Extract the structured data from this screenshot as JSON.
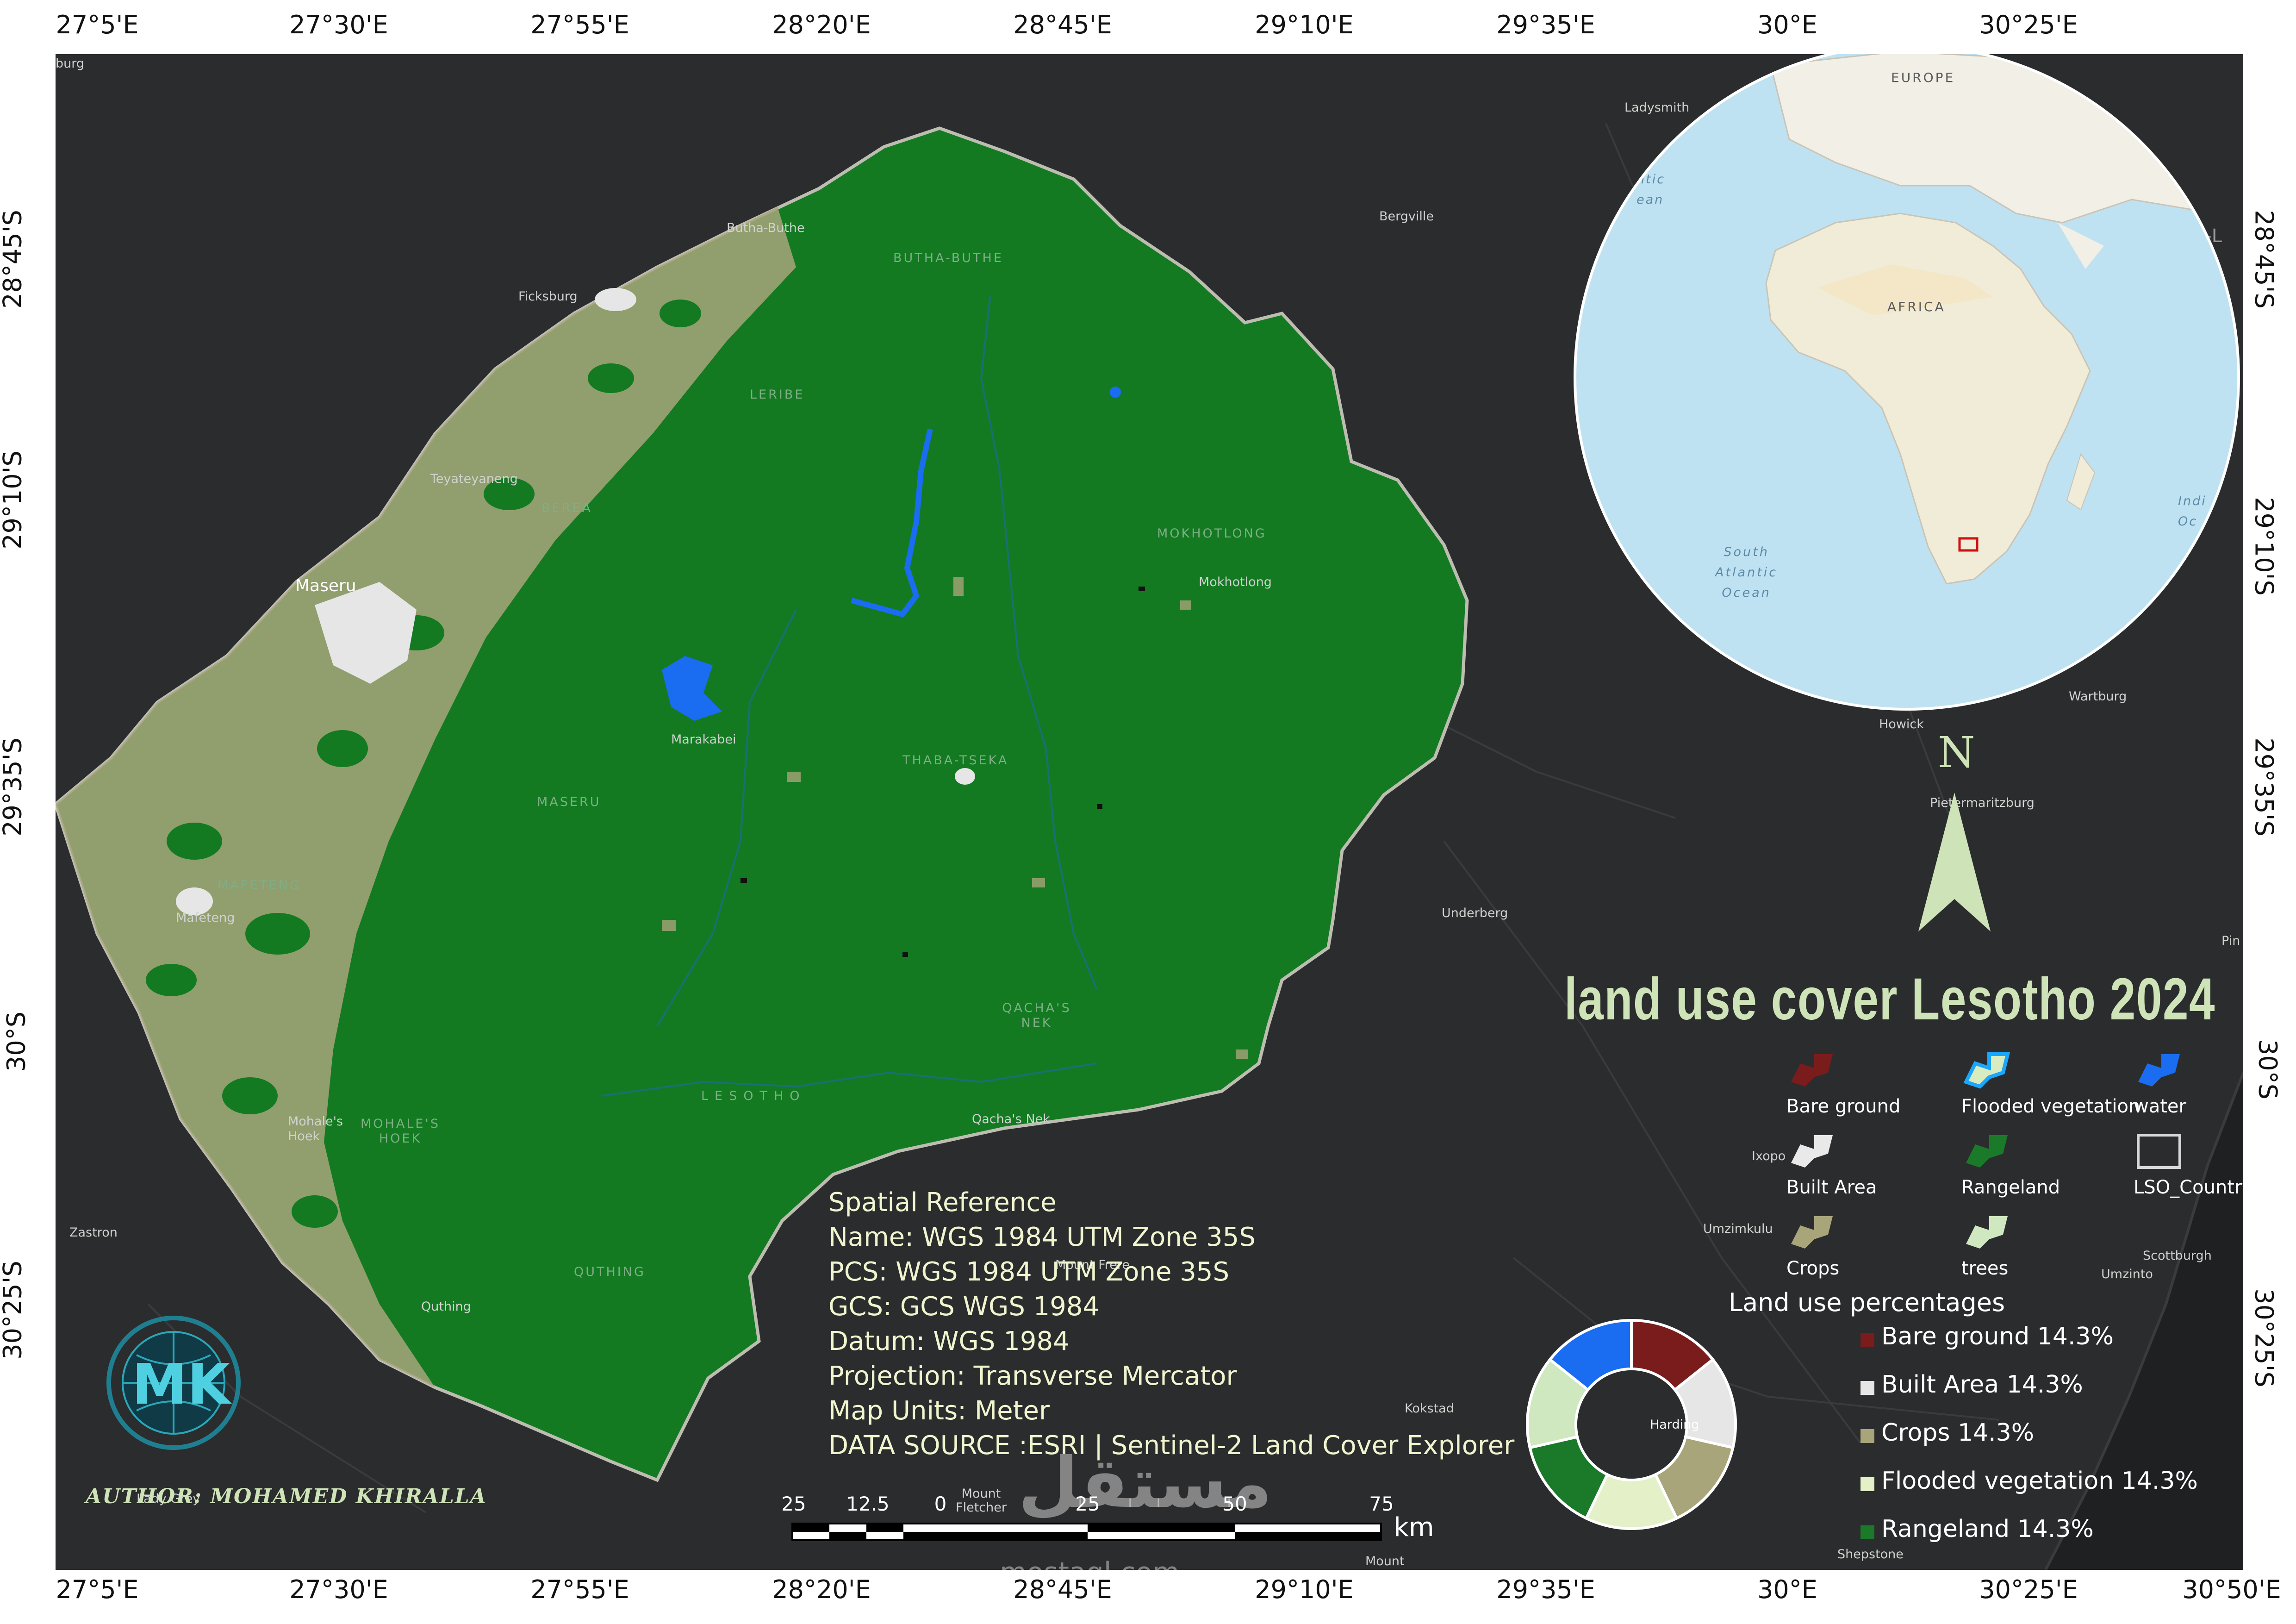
{
  "graticule": {
    "top": [
      "27°5'E",
      "27°30'E",
      "27°55'E",
      "28°20'E",
      "28°45'E",
      "29°10'E",
      "29°35'E",
      "30°E",
      "30°25'E"
    ],
    "bottom": [
      "27°5'E",
      "27°30'E",
      "27°55'E",
      "28°20'E",
      "28°45'E",
      "29°10'E",
      "29°35'E",
      "30°E",
      "30°25'E",
      "30°50'E"
    ],
    "left": [
      "28°45'S",
      "29°10'S",
      "29°35'S",
      "30°S",
      "30°25'S"
    ],
    "right": [
      "28°45'S",
      "29°10'S",
      "29°35'S",
      "30°S",
      "30°25'S"
    ]
  },
  "places": [
    "burg",
    "Ficksburg",
    "Teyateyaneng",
    "Maseru",
    "Mafeteng",
    "Mohale's Hoek",
    "Quthing",
    "Zastron",
    "Lady Grey",
    "Butha-Buthe",
    "Marakabei",
    "Mokhotlong",
    "Qacha's Nek",
    "Ladysmith",
    "Bergville",
    "Underberg",
    "Pietermaritzburg",
    "Howick",
    "Wartburg",
    "Ixopo",
    "Umzimkulu",
    "Scottburgh",
    "Umzinto",
    "Kokstad",
    "Shepstone",
    "Harding",
    "Mount Fletcher",
    "Mount",
    "Mount Frere",
    "U-L",
    "Pin"
  ],
  "districts": [
    "BUTHA-BUTHE",
    "LERIBE",
    "BEREA",
    "MASERU",
    "MAFETENG",
    "MOHALE'S HOEK",
    "QUTHING",
    "THABA-TSEKA",
    "MOKHOTLONG",
    "QACHA'S NEK",
    "LESOTHO"
  ],
  "inset": {
    "labels": [
      "EUROPE",
      "AFRICA",
      "South Atlantic Ocean",
      "Atlantic Ocean",
      "Indian Ocean"
    ],
    "ocean_lines": [
      "South",
      "Atlantic",
      "Ocean"
    ],
    "atlantic_lines": [
      "ntic",
      "ean"
    ],
    "indian_lines": [
      "Indi",
      "Oc"
    ]
  },
  "north_arrow": {
    "label": "N"
  },
  "title": "land use cover Lesotho 2024",
  "legend": [
    {
      "label": "Bare ground",
      "color": "#7a1c1c"
    },
    {
      "label": "Flooded vegetation",
      "color": "#d8ecc0"
    },
    {
      "label": "water",
      "color": "#1a6cf0"
    },
    {
      "label": "Built Area",
      "color": "#e9e9e9"
    },
    {
      "label": "Rangeland",
      "color": "#1b7a2a"
    },
    {
      "label": "LSO_Country",
      "color": "#2b2c2d"
    },
    {
      "label": "Crops",
      "color": "#a8a57a"
    },
    {
      "label": "trees",
      "color": "#cfe8bf"
    }
  ],
  "spatial_reference": [
    "Spatial Reference",
    "Name: WGS 1984 UTM Zone 35S",
    "PCS: WGS 1984 UTM Zone 35S",
    "GCS: GCS WGS 1984",
    "Datum: WGS 1984",
    "Projection: Transverse Mercator",
    "Map Units: Meter",
    "DATA SOURCE :ESRI | Sentinel-2 Land Cover Explorer"
  ],
  "author": "AUTHOR: MOHAMED KHIRALLA",
  "logo_text": "MK",
  "watermark": {
    "arabic": "مستقل",
    "latin": "mostaql.com"
  },
  "scale_bar": {
    "labels": [
      "25",
      "12.5",
      "0",
      "25",
      "50",
      "75"
    ],
    "unit": "km"
  },
  "chart_data": {
    "type": "pie",
    "title": "Land use percentages",
    "categories": [
      "Bare ground",
      "Built Area",
      "Crops",
      "Flooded vegetation",
      "Rangeland",
      "trees",
      "water"
    ],
    "values": [
      14.3,
      14.3,
      14.3,
      14.3,
      14.3,
      14.3,
      14.3
    ],
    "colors": [
      "#7a1c1c",
      "#e6e6e6",
      "#a8a57a",
      "#e3f0c8",
      "#1b7a2a",
      "#cfe8bf",
      "#1a6cf0"
    ],
    "legend_labels": [
      "Bare ground 14.3%",
      "Built Area 14.3%",
      "Crops 14.3%",
      "Flooded vegetation 14.3%",
      "Rangeland 14.3%"
    ]
  }
}
